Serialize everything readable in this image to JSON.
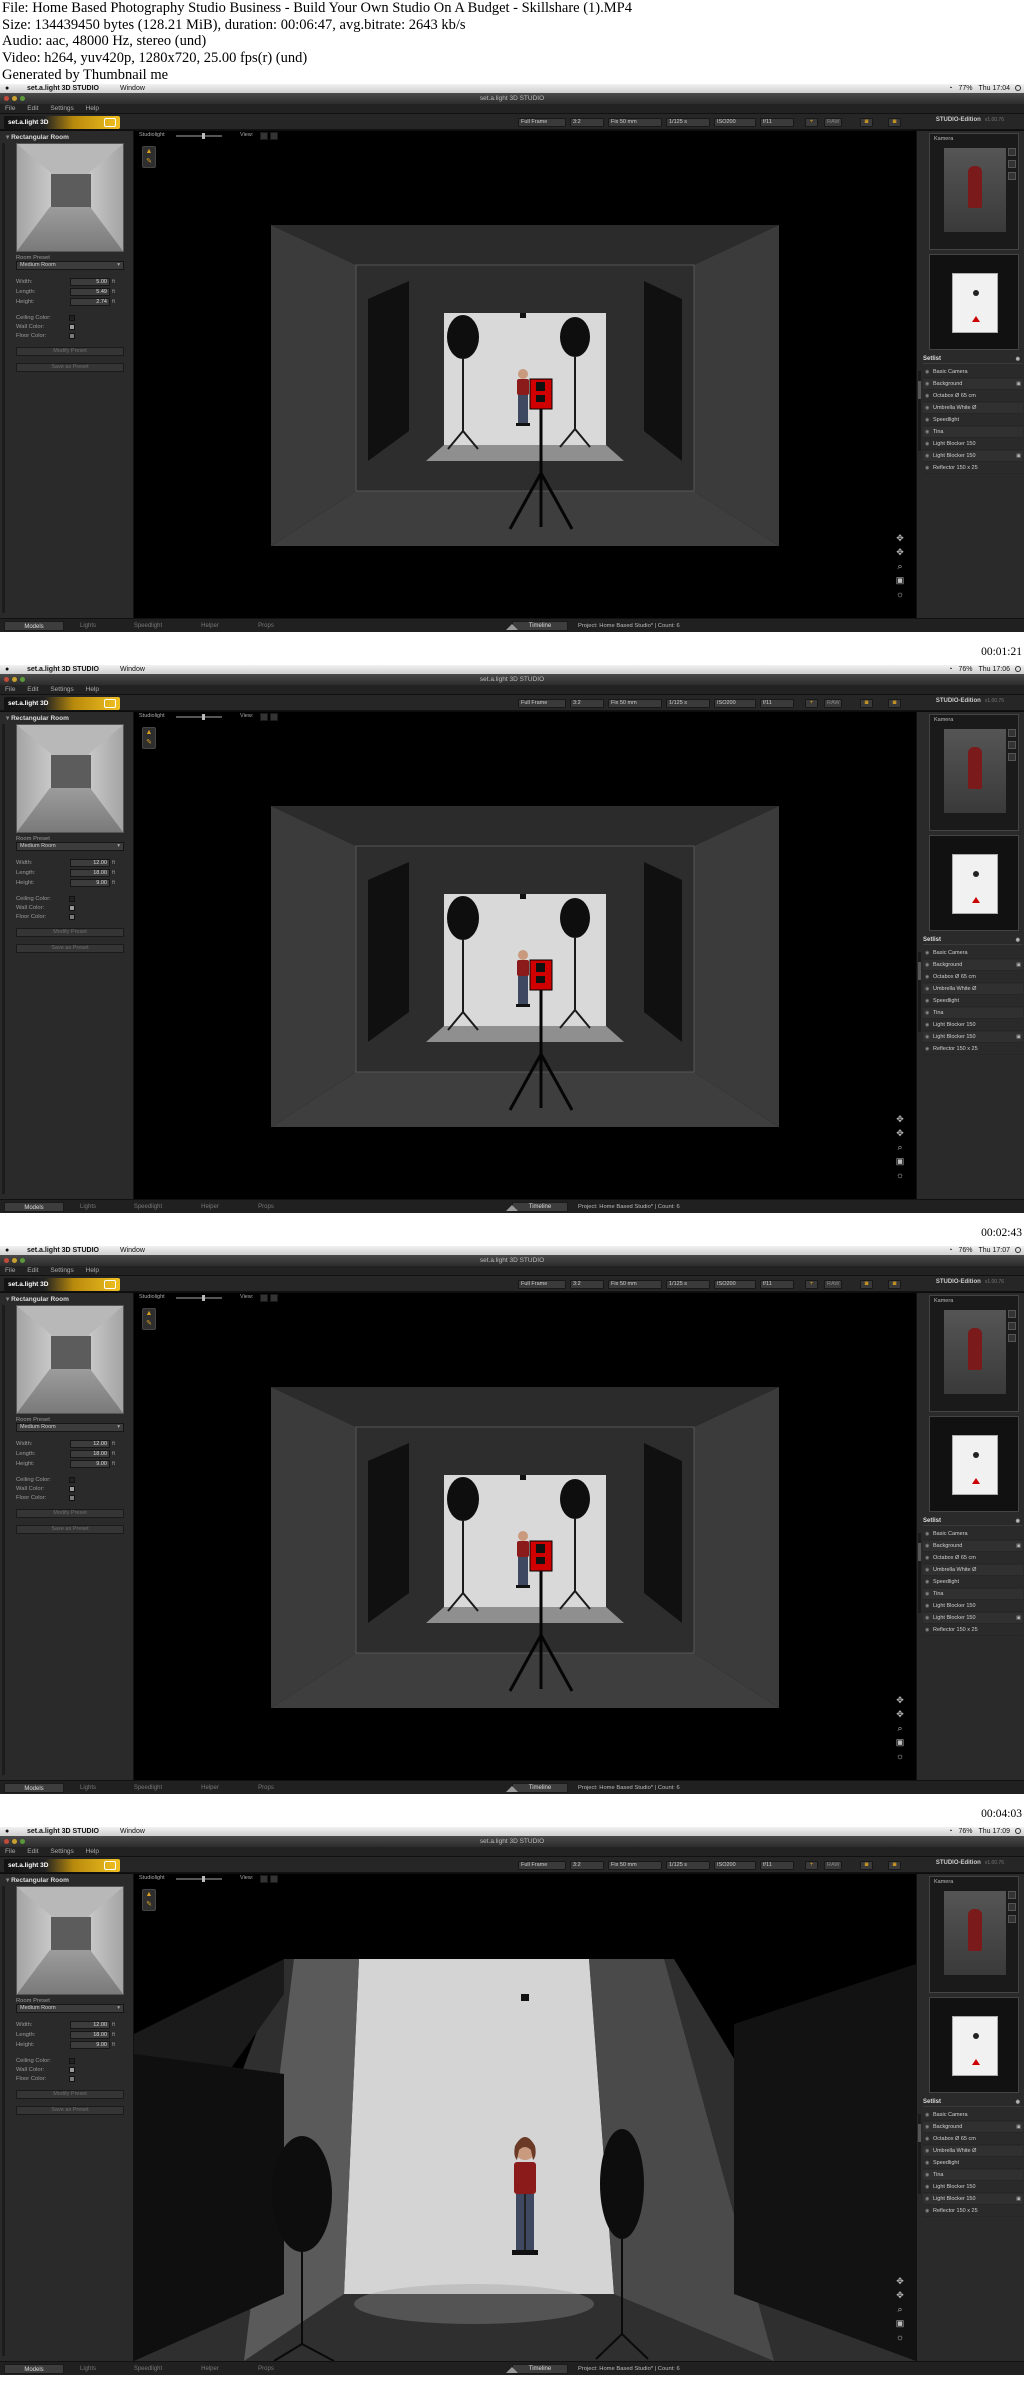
{
  "header": {
    "line1": "File: Home Based Photography Studio Business - Build Your Own Studio On A Budget - Skillshare (1).MP4",
    "line2": "Size: 134439450 bytes (128.21 MiB), duration: 00:06:47, avg.bitrate: 2643 kb/s",
    "line3": "Audio: aac, 48000 Hz, stereo (und)",
    "line4": "Video: h264, yuv420p, 1280x720, 25.00 fps(r) (und)",
    "line5": "Generated by Thumbnail me"
  },
  "app": {
    "name": "set.a.light 3D STUDIO",
    "menu_window": "Window",
    "window_title": "set.a.light 3D STUDIO",
    "menus": [
      "File",
      "Edit",
      "Settings",
      "Help"
    ],
    "edition": "STUDIO-Edition",
    "version": "v1.00.76",
    "logo_text": "set.a.light 3D",
    "toolbar": {
      "sensor": "Full Frame",
      "ratio": "3:2",
      "lens": "Fix 50 mm",
      "shutter": "1/125 s",
      "iso": "ISO200",
      "aperture": "f/11",
      "plus": "+",
      "raw": "RAW"
    },
    "left_panel": {
      "title": "Rectangular Room",
      "room_preset_label": "Room Preset",
      "room_preset_value": "Medium Room",
      "width_label": "Width:",
      "length_label": "Length:",
      "height_label": "Height:",
      "unit": "ft",
      "ceiling_label": "Ceiling Color:",
      "wall_label": "Wall Color:",
      "floor_label": "Floor Color:",
      "modify_btn": "Modify Preset",
      "save_btn": "Save as Preset"
    },
    "viewport": {
      "studiolight_label": "Studiolight",
      "view_label": "View:"
    },
    "right_panel": {
      "preview_label": "Kamera",
      "setlist_title": "Setlist",
      "setlist": [
        "Basic Camera",
        "Background",
        "Octabox Ø 65 cm",
        "Umbrella White Ø",
        "Speedlight",
        "Tina",
        "Light Blocker 150",
        "Light Blocker 150",
        "Reflector 150 x 25"
      ]
    },
    "bottom": {
      "tabs": [
        "Models",
        "Lights",
        "Speedlight",
        "Helper",
        "Props"
      ],
      "timeline": "Timeline",
      "project": "Project: Home Based Studio*  |  Count: 6"
    }
  },
  "frames": [
    {
      "clock": "Thu 17:04",
      "battery": "77%",
      "width": "5.00",
      "length": "5.49",
      "height": "2.74",
      "timestamp": "00:01:21"
    },
    {
      "clock": "Thu 17:06",
      "battery": "76%",
      "width": "12.00",
      "length": "18.00",
      "height": "9.00",
      "timestamp": "00:02:43"
    },
    {
      "clock": "Thu 17:07",
      "battery": "76%",
      "width": "12.00",
      "length": "18.00",
      "height": "9.00",
      "timestamp": "00:04:03"
    },
    {
      "clock": "Thu 17:09",
      "battery": "76%",
      "width": "12.00",
      "length": "18.00",
      "height": "9.00",
      "timestamp": "00:05:25"
    }
  ]
}
